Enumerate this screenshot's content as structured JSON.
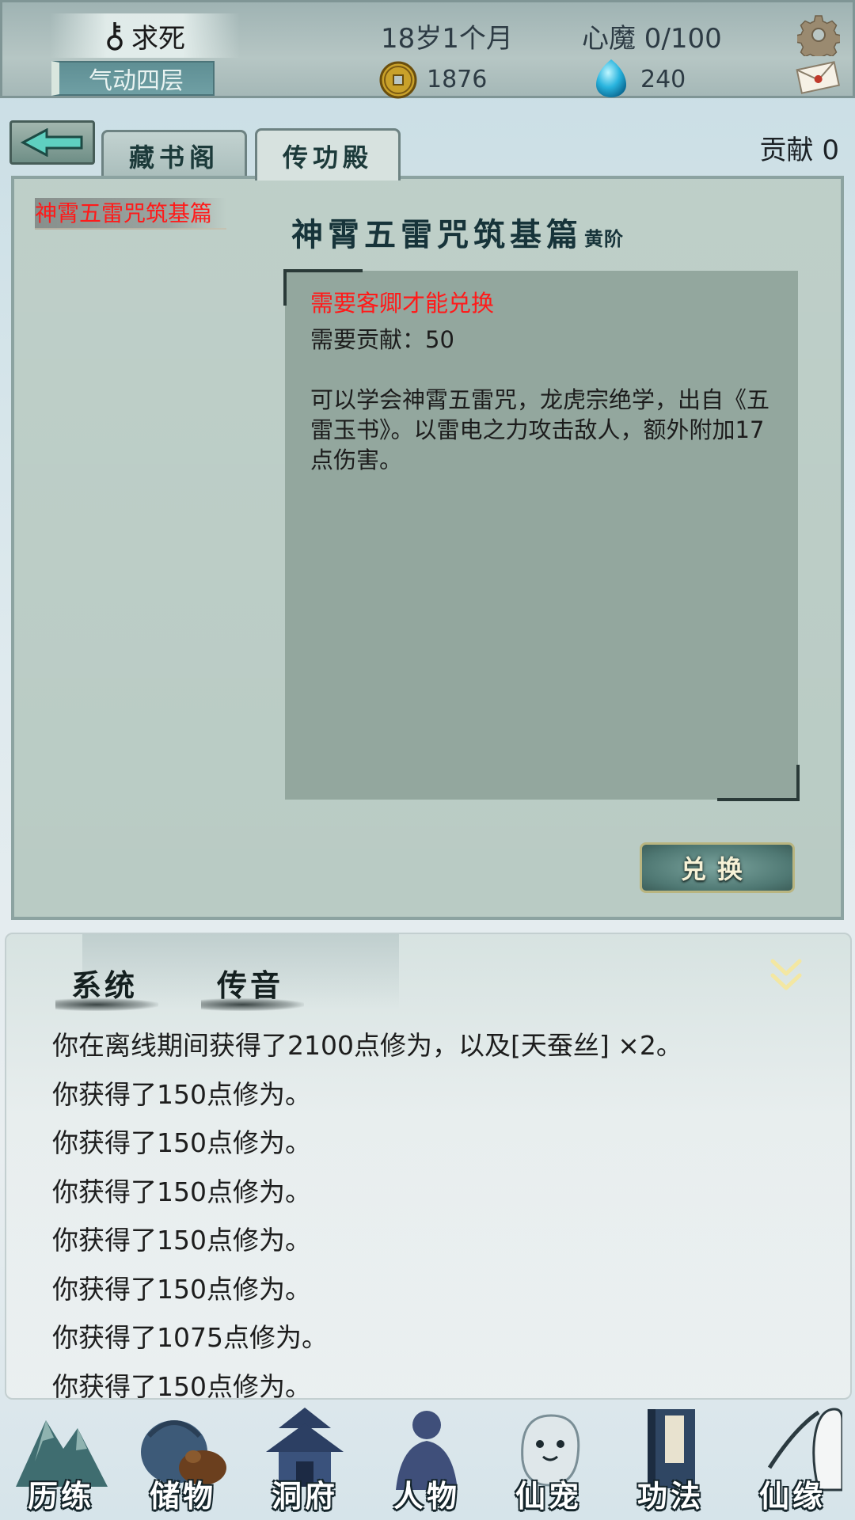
{
  "status": {
    "name": "求死",
    "realm": "气动四层",
    "age": "18岁1个月",
    "heart_demon": "心魔  0/100",
    "coins": "1876",
    "spirit_stones": "240"
  },
  "tabs": {
    "library": "藏书阁",
    "hall": "传功殿",
    "active": "传功殿"
  },
  "contribution": "贡献  0",
  "list": {
    "items": [
      "神霄五雷咒筑基篇"
    ],
    "selected": "神霄五雷咒筑基篇"
  },
  "detail": {
    "title": "神霄五雷咒筑基篇",
    "grade": "黄阶",
    "requirement": "需要客卿才能兑换",
    "cost": "需要贡献：50",
    "description": "可以学会神霄五雷咒，龙虎宗绝学，出自《五雷玉书》。以雷电之力攻击敌人，额外附加17点伤害。",
    "exchange_label": "兑换"
  },
  "chat": {
    "tab_system": "系统",
    "tab_message": "传音",
    "lines": [
      "你在离线期间获得了2100点修为，以及[天蚕丝] ×2。",
      "你获得了150点修为。",
      "你获得了150点修为。",
      "你获得了150点修为。",
      "你获得了150点修为。",
      "你获得了150点修为。",
      "你获得了1075点修为。",
      "你获得了150点修为。"
    ]
  },
  "nav": [
    {
      "label": "历练",
      "icon": "mountain-icon"
    },
    {
      "label": "储物",
      "icon": "pouch-icon"
    },
    {
      "label": "洞府",
      "icon": "pavilion-icon"
    },
    {
      "label": "人物",
      "icon": "person-icon"
    },
    {
      "label": "仙宠",
      "icon": "spirit-pet-icon"
    },
    {
      "label": "功法",
      "icon": "scripture-book-icon"
    },
    {
      "label": "仙缘",
      "icon": "crane-icon"
    }
  ],
  "colors": {
    "warning_red": "#ff1a1a",
    "panel": "#b9cbc4",
    "description_box": "#93a79e",
    "realm_badge": "#6f9fa4"
  }
}
